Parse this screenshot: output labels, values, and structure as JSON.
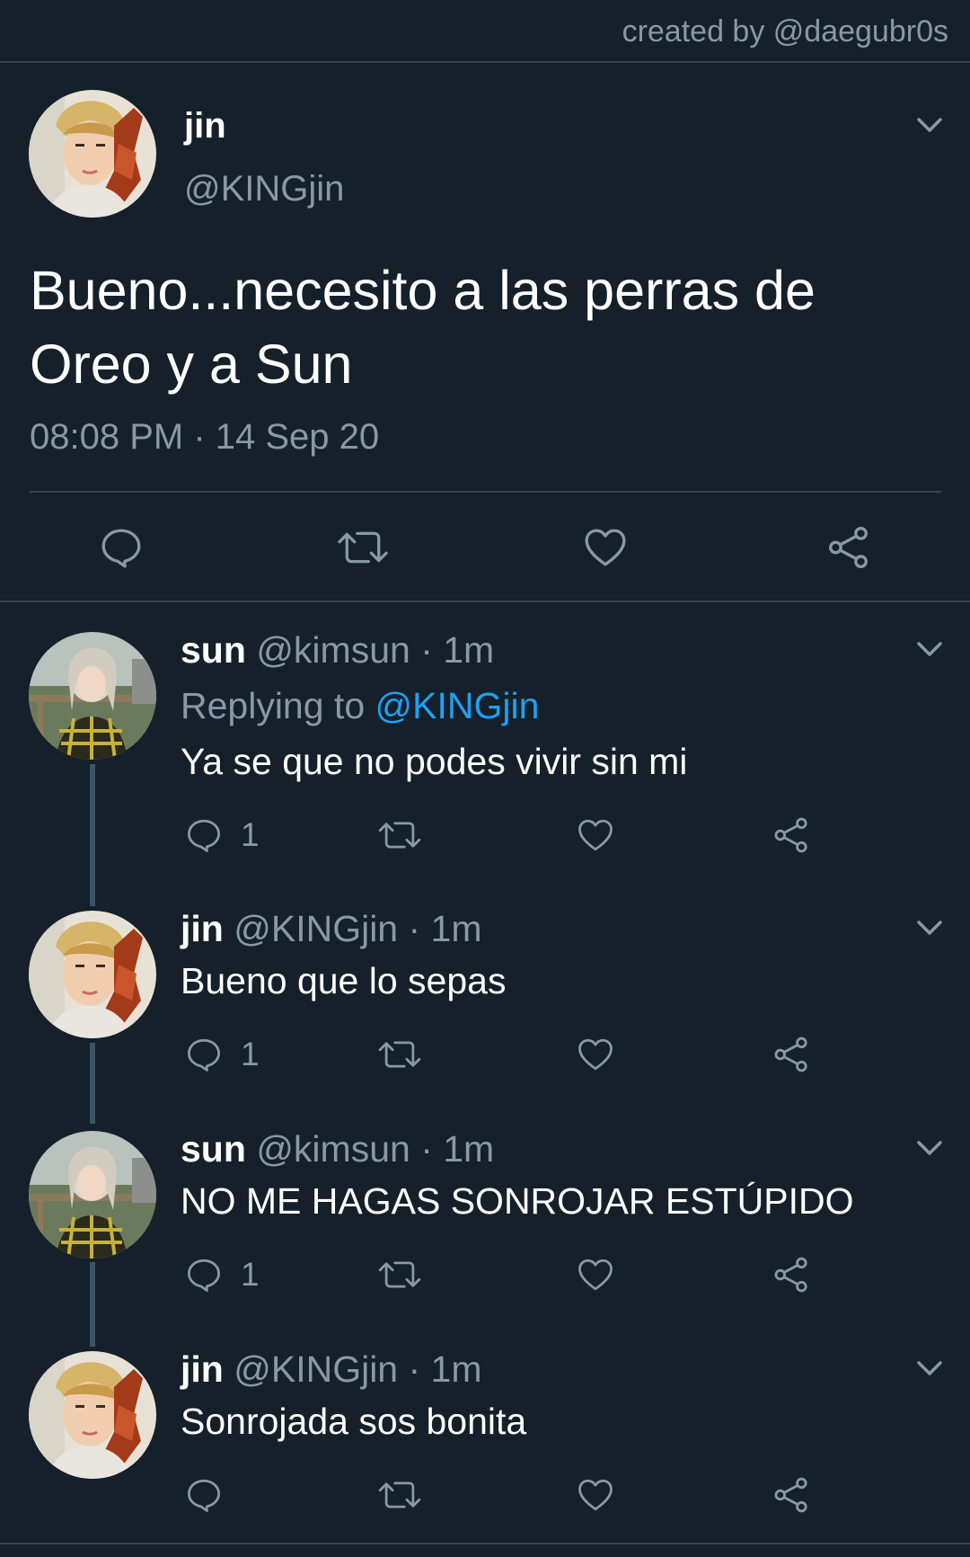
{
  "credit": "created by @daegubr0s",
  "main_tweet": {
    "name": "jin",
    "handle": "@KINGjin",
    "text": "Bueno...necesito a las perras de Oreo y a Sun",
    "timestamp": "08:08 PM · 14 Sep 20",
    "actions": [
      "comment-icon",
      "retweet-icon",
      "like-icon",
      "share-icon"
    ]
  },
  "replies": [
    {
      "name": "sun",
      "meta": "@kimsun · 1m",
      "replying_prefix": "Replying to",
      "replying_handle": "@KINGjin",
      "text": "Ya se que no podes vivir sin mi",
      "reply_count": "1"
    },
    {
      "name": "jin",
      "meta": "@KINGjin · 1m",
      "text": "Bueno que lo sepas",
      "reply_count": "1"
    },
    {
      "name": "sun",
      "meta": "@kimsun · 1m",
      "text": "NO ME HAGAS SONROJAR ESTÚPIDO",
      "reply_count": "1"
    },
    {
      "name": "jin",
      "meta": "@KINGjin · 1m",
      "text": "Sonrojada sos bonita",
      "reply_count": ""
    }
  ],
  "colors": {
    "background": "#15202b",
    "text": "#ffffff",
    "secondary": "#8899a6",
    "link": "#1da1f2",
    "divider": "#38444d",
    "thread_line": "#3d5466"
  }
}
